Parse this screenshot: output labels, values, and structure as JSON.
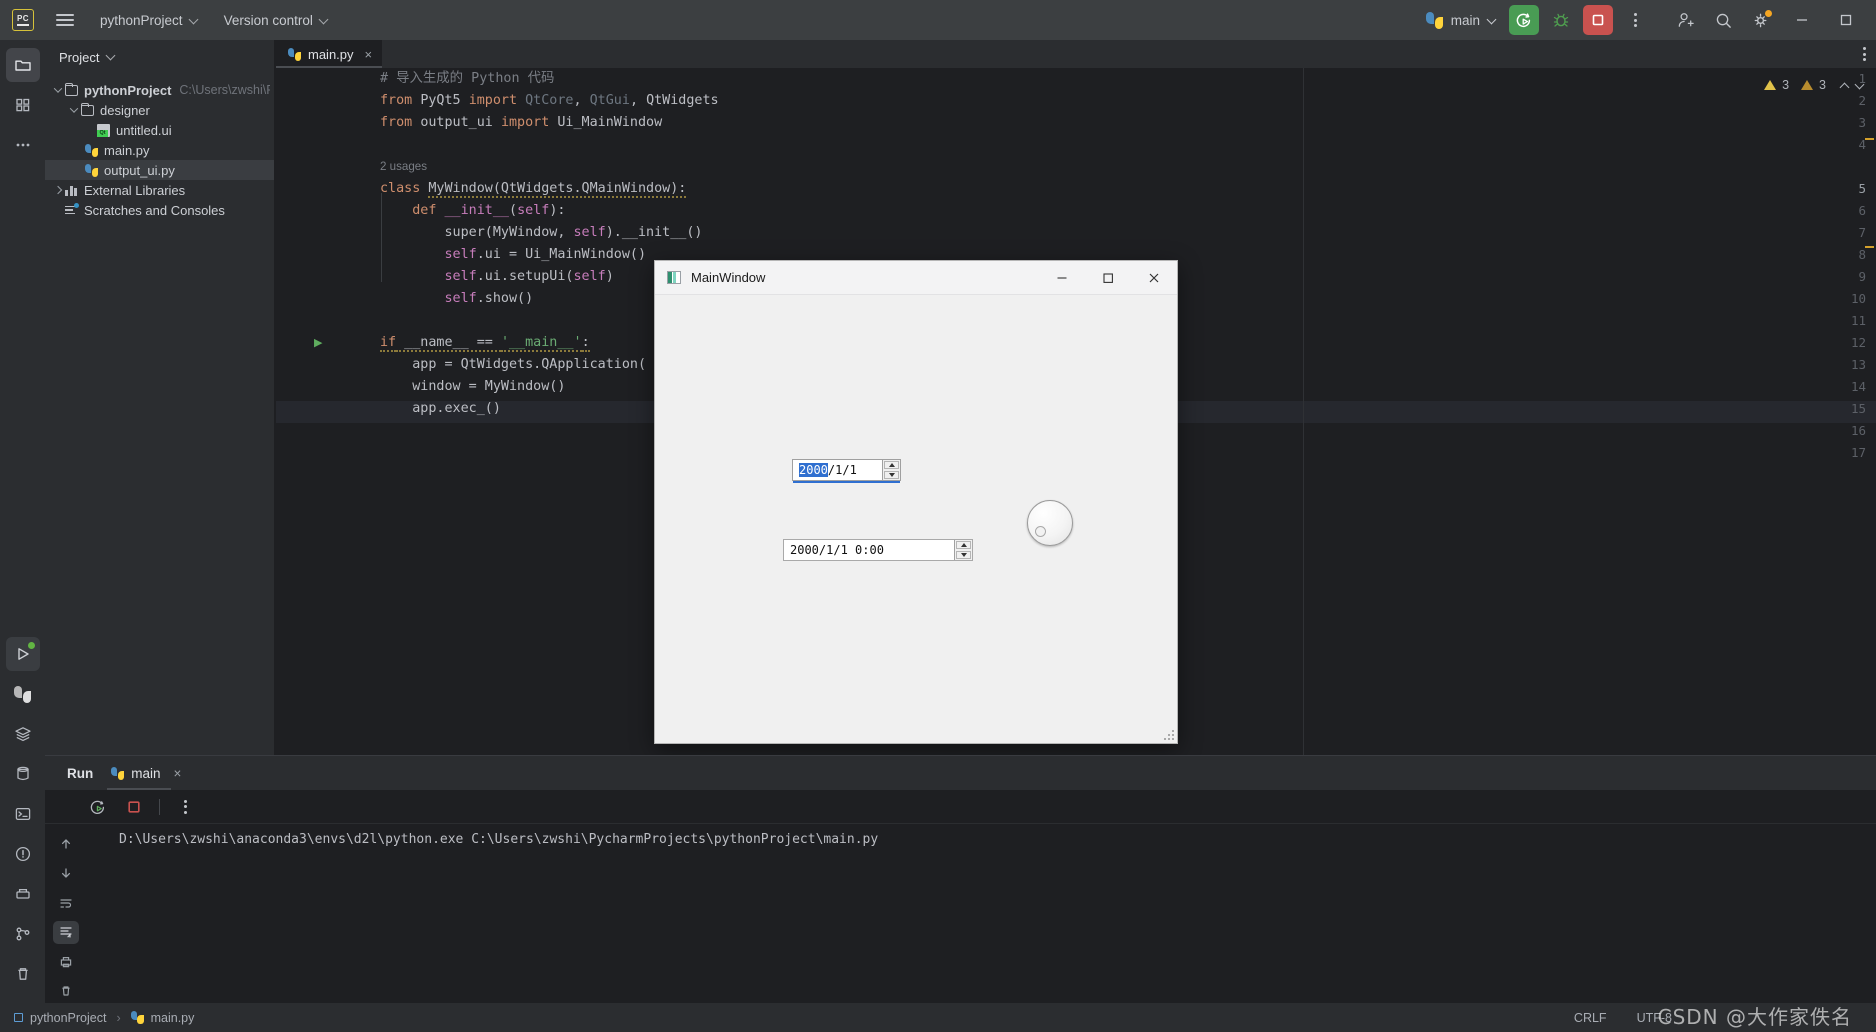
{
  "app": {
    "logo_text": "PC",
    "project_name": "pythonProject",
    "vcs_label": "Version control",
    "menu_icon": "hamburger-menu-icon"
  },
  "topbar": {
    "run_config": "main",
    "run_icon": "run-with-coverage-icon",
    "debug_icon": "debug-bug-icon",
    "stop_icon": "stop-square-icon",
    "more_icon": "more-vertical-icon",
    "account_icon": "add-user-icon",
    "search_icon": "search-icon",
    "settings_icon": "gear-icon",
    "minimize_icon": "window-minimize-icon",
    "maximize_icon": "window-maximize-icon"
  },
  "rail": {
    "items": [
      {
        "name": "project-tool-icon",
        "glyph": "folder"
      },
      {
        "name": "structure-tool-icon",
        "glyph": "blocks"
      },
      {
        "name": "more-tool-icon",
        "glyph": "dots"
      }
    ],
    "bottom": [
      {
        "name": "run-tool-icon",
        "glyph": "play"
      },
      {
        "name": "python-console-icon",
        "glyph": "python"
      },
      {
        "name": "services-icon",
        "glyph": "layers"
      },
      {
        "name": "database-icon",
        "glyph": "db"
      },
      {
        "name": "terminal-icon",
        "glyph": "terminal"
      },
      {
        "name": "problems-icon",
        "glyph": "warning"
      },
      {
        "name": "build-icon",
        "glyph": "build"
      },
      {
        "name": "git-icon",
        "glyph": "git"
      },
      {
        "name": "trash-icon",
        "glyph": "trash"
      }
    ]
  },
  "project_panel": {
    "title": "Project",
    "tree": [
      {
        "label": "pythonProject",
        "path": "C:\\Users\\zwshi\\Pych",
        "icon": "folder-icon",
        "depth": 0,
        "arrow": "down",
        "selected": false
      },
      {
        "label": "designer",
        "path": "",
        "icon": "folder-icon",
        "depth": 1,
        "arrow": "down",
        "selected": false
      },
      {
        "label": "untitled.ui",
        "path": "",
        "icon": "qt-designer-icon",
        "depth": 2,
        "arrow": "none",
        "selected": false
      },
      {
        "label": "main.py",
        "path": "",
        "icon": "python-file-icon",
        "depth": 2,
        "arrow": "none",
        "selected": false
      },
      {
        "label": "output_ui.py",
        "path": "",
        "icon": "python-file-icon",
        "depth": 2,
        "arrow": "none",
        "selected": true
      },
      {
        "label": "External Libraries",
        "path": "",
        "icon": "library-icon",
        "depth": 0,
        "arrow": "right",
        "selected": false
      },
      {
        "label": "Scratches and Consoles",
        "path": "",
        "icon": "scratches-icon",
        "depth": 0,
        "arrow": "none",
        "selected": false
      }
    ]
  },
  "editor": {
    "tab": {
      "label": "main.py",
      "icon": "python-file-icon",
      "close": "×"
    },
    "inspection": {
      "warning_count": "3",
      "weak_warning_count": "3",
      "up_icon": "chevron-up-icon",
      "down_icon": "chevron-down-icon"
    },
    "usages_hint": "2 usages",
    "lines": [
      {
        "n": "1",
        "text": "# 导入生成的 Python 代码"
      },
      {
        "n": "2",
        "text": "from PyQt5 import QtCore, QtGui, QtWidgets"
      },
      {
        "n": "3",
        "text": "from output_ui import Ui_MainWindow"
      },
      {
        "n": "4",
        "text": ""
      },
      {
        "n": "",
        "text": "2 usages"
      },
      {
        "n": "5",
        "text": "class MyWindow(QtWidgets.QMainWindow):"
      },
      {
        "n": "6",
        "text": "    def __init__(self):"
      },
      {
        "n": "7",
        "text": "        super(MyWindow, self).__init__()"
      },
      {
        "n": "8",
        "text": "        self.ui = Ui_MainWindow()"
      },
      {
        "n": "9",
        "text": "        self.ui.setupUi(self)"
      },
      {
        "n": "10",
        "text": "        self.show()"
      },
      {
        "n": "11",
        "text": ""
      },
      {
        "n": "12",
        "text": "if __name__ == '__main__':"
      },
      {
        "n": "13",
        "text": "    app = QtWidgets.QApplication(sys.argv)"
      },
      {
        "n": "14",
        "text": "    window = MyWindow()"
      },
      {
        "n": "15",
        "text": "    app.exec_()"
      },
      {
        "n": "16",
        "text": ""
      },
      {
        "n": "17",
        "text": ""
      }
    ]
  },
  "qt_window": {
    "title": "MainWindow",
    "app_icon": "qt-app-icon",
    "minimize": "—",
    "maximize": "□",
    "close": "✕",
    "date_edit": {
      "selected_part": "2000",
      "rest": "/1/1",
      "spin_up": "spin-up-icon",
      "spin_down": "spin-down-icon"
    },
    "datetime_edit": {
      "value": "2000/1/1  0:00",
      "spin_up": "spin-up-icon",
      "spin_down": "spin-down-icon"
    },
    "dial": {
      "name": "dial-widget",
      "value_position": "lower-left"
    }
  },
  "run_panel": {
    "title": "Run",
    "tab": {
      "label": "main",
      "icon": "python-file-icon",
      "close": "×"
    },
    "toolbar": {
      "rerun_icon": "rerun-icon",
      "stop_icon": "stop-icon",
      "more_icon": "more-vertical-icon"
    },
    "side_icons": [
      "scroll-up-icon",
      "scroll-down-icon",
      "soft-wrap-icon",
      "scroll-to-end-icon",
      "print-icon",
      "clear-all-icon"
    ],
    "console_output": "D:\\Users\\zwshi\\anaconda3\\envs\\d2l\\python.exe C:\\Users\\zwshi\\PycharmProjects\\pythonProject\\main.py"
  },
  "status_bar": {
    "breadcrumb_project": "pythonProject",
    "breadcrumb_file": "main.py",
    "separator": "›",
    "line_separator": "CRLF",
    "encoding": "UTF-8",
    "watermark": "CSDN @大作家佚名"
  },
  "colors": {
    "accent_green": "#499c54",
    "accent_red": "#c9524f",
    "selection_blue": "#2f6fd0",
    "bg_dark": "#1e1f22",
    "bg_panel": "#2b2d30",
    "bg_topbar": "#3c3f41"
  }
}
